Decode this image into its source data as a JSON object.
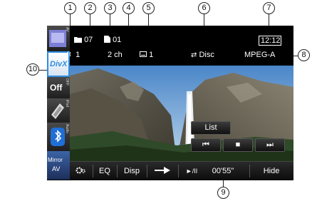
{
  "top_info": {
    "folder_number": "07",
    "file_number": "01",
    "audio_track": "1",
    "channels": "2 ch",
    "subtitle": "1",
    "repeat": "Disc",
    "clock": "12:12",
    "audio_format": "MPEG-A"
  },
  "sidebar": {
    "tab_av_label": "AV",
    "tab_divx_label": "DivX",
    "tab_off_label": "Off",
    "tab_off_vlabel": "OFF",
    "tab_ipod_vlabel": "iPod",
    "tab_audio_vlabel": "Audio",
    "tab_mirror_line1": "Mirror",
    "tab_mirror_line2": "AV"
  },
  "controls": {
    "list_label": "List",
    "prev_label": "⏮",
    "stop_label": "■",
    "next_label": "⏭"
  },
  "bottom_bar": {
    "eq_label": "EQ",
    "disp_label": "Disp",
    "play_pause_label": "►/II",
    "elapsed_time": "00'55\"",
    "hide_label": "Hide"
  },
  "callouts": [
    "1",
    "2",
    "3",
    "4",
    "5",
    "6",
    "7",
    "8",
    "9",
    "10"
  ],
  "colors": {
    "divx_accent": "#2f8de0",
    "screen_bg": "#000000",
    "text": "#ffffff"
  },
  "icons": [
    "folder-icon",
    "file-icon",
    "audio-track-icon",
    "subtitle-icon",
    "repeat-icon",
    "settings-icon",
    "arrow-right-icon",
    "bluetooth-icon"
  ]
}
